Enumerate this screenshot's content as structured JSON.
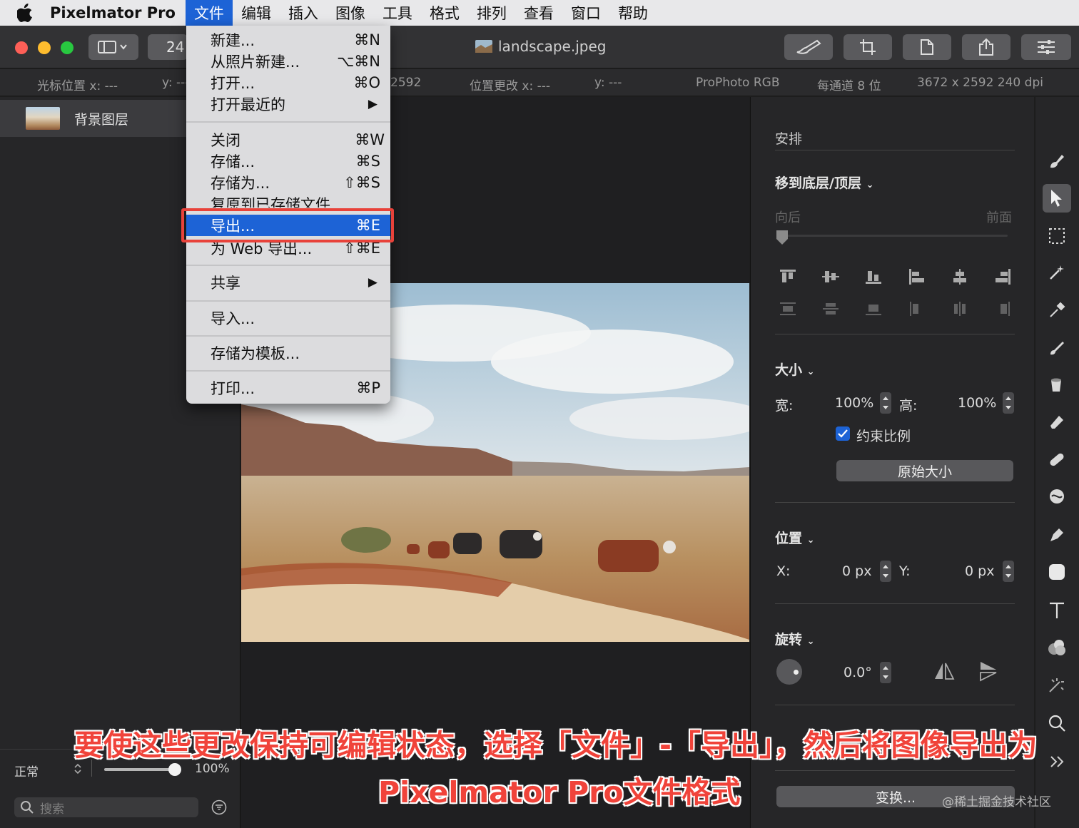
{
  "menubar": {
    "app_name": "Pixelmator Pro",
    "items": [
      "文件",
      "编辑",
      "插入",
      "图像",
      "工具",
      "格式",
      "排列",
      "查看",
      "窗口",
      "帮助"
    ]
  },
  "titlebar": {
    "zoom_partial": "24",
    "document_title": "landscape.jpeg"
  },
  "infobar": {
    "cursor_x": "光标位置 x:  ---",
    "cursor_y": "y:  ---",
    "size_partial": "2592",
    "pos_change_x": "位置更改 x:  ---",
    "pos_change_y": "y:  ---",
    "color_profile": "ProPhoto RGB",
    "bit_depth": "每通道 8 位",
    "dimensions": "3672 x 2592 240 dpi"
  },
  "layers": {
    "background_layer": "背景图层",
    "blend_mode": "正常",
    "opacity": "100%",
    "search_placeholder": "搜索"
  },
  "file_menu": {
    "items": [
      {
        "label": "新建...",
        "shortcut": "⌘N"
      },
      {
        "label": "从照片新建...",
        "shortcut": "⌥⌘N"
      },
      {
        "label": "打开...",
        "shortcut": "⌘O"
      },
      {
        "label": "打开最近的",
        "shortcut": "▶"
      },
      {
        "label": "关闭",
        "shortcut": "⌘W"
      },
      {
        "label": "存储...",
        "shortcut": "⌘S"
      },
      {
        "label": "存储为...",
        "shortcut": "⇧⌘S"
      },
      {
        "label": "复原到已存储文件",
        "shortcut": ""
      },
      {
        "label": "导出...",
        "shortcut": "⌘E"
      },
      {
        "label": "为 Web 导出...",
        "shortcut": "⇧⌘E"
      },
      {
        "label": "共享",
        "shortcut": "▶"
      },
      {
        "label": "导入...",
        "shortcut": ""
      },
      {
        "label": "存储为模板...",
        "shortcut": ""
      },
      {
        "label": "打印...",
        "shortcut": "⌘P"
      }
    ]
  },
  "arrange_panel": {
    "title": "安排",
    "move_to": "移到底层/顶层",
    "back": "向后",
    "front": "前面",
    "size_title": "大小",
    "width_label": "宽:",
    "width_value": "100%",
    "height_label": "高:",
    "height_value": "100%",
    "constrain": "约束比例",
    "original_size": "原始大小",
    "position_title": "位置",
    "x_label": "X:",
    "x_value": "0 px",
    "y_label": "Y:",
    "y_value": "0 px",
    "rotate_title": "旋转",
    "rotate_value": "0.0°",
    "transform_button": "变换..."
  },
  "caption": {
    "line1": "要使这些更改保持可编辑状态，选择「文件」-「导出」，然后将图像导出为",
    "line2": "Pixelmator Pro文件格式"
  },
  "watermark": "@稀土掘金技术社区",
  "colors": {
    "accent": "#1d63d6",
    "callout": "#e8423a",
    "traffic_red": "#fe5f57",
    "traffic_yellow": "#febc2e",
    "traffic_green": "#28c840"
  }
}
